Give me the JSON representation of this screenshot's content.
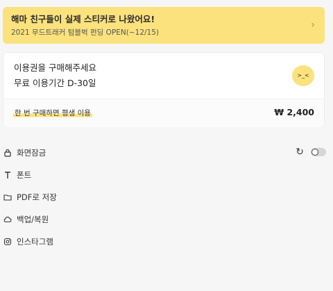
{
  "banner": {
    "title": "해마 친구들이 실제 스티커로 나왔어요!",
    "subtitle": "2021 무드트래커 텀블벅 펀딩 OPEN(~12/15)"
  },
  "card": {
    "title": "이용권을 구매해주세요",
    "period": "무료 이용기간 D-30일",
    "promo": "한 번 구매하면 평생 이용",
    "price": "₩ 2,400"
  },
  "menu": [
    {
      "label": "화면잠금",
      "icon": "lock-icon"
    },
    {
      "label": "폰트",
      "icon": "font-icon"
    },
    {
      "label": "PDF로 저장",
      "icon": "folder-icon"
    },
    {
      "label": "백업/복원",
      "icon": "cloud-icon"
    },
    {
      "label": "인스타그램",
      "icon": "instagram-icon"
    }
  ],
  "lock_toggle": {
    "on": false
  }
}
